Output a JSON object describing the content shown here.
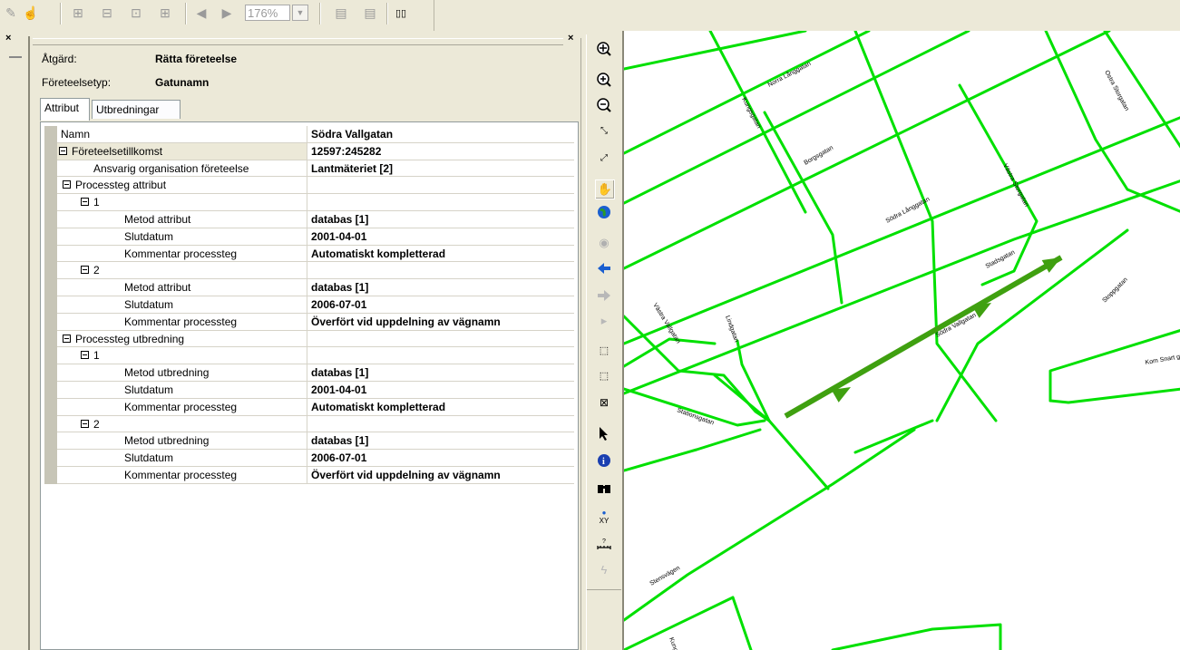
{
  "toolbar": {
    "zoom_value": "176%"
  },
  "panel": {
    "action_label": "Åtgärd:",
    "action_value": "Rätta företeelse",
    "type_label": "Företeelsetyp:",
    "type_value": "Gatunamn",
    "tabs": [
      {
        "label": "Attribut"
      },
      {
        "label": "Utbredningar"
      }
    ]
  },
  "grid": {
    "rows": [
      {
        "name": "Namn",
        "value": "Södra Vallgatan"
      },
      {
        "name": "Företeelsetillkomst",
        "value": "12597:245282"
      },
      {
        "name": "Ansvarig organisation företeelse",
        "value": "Lantmäteriet [2]"
      },
      {
        "name": "Processteg attribut",
        "value": ""
      },
      {
        "name": "1",
        "value": ""
      },
      {
        "name": "Metod attribut",
        "value": "databas [1]"
      },
      {
        "name": "Slutdatum",
        "value": "2001-04-01"
      },
      {
        "name": "Kommentar processteg",
        "value": "Automatiskt kompletterad"
      },
      {
        "name": "2",
        "value": ""
      },
      {
        "name": "Metod attribut",
        "value": "databas [1]"
      },
      {
        "name": "Slutdatum",
        "value": "2006-07-01"
      },
      {
        "name": "Kommentar processteg",
        "value": "Överfört vid uppdelning av vägnamn"
      },
      {
        "name": "Processteg utbredning",
        "value": ""
      },
      {
        "name": "1",
        "value": ""
      },
      {
        "name": "Metod utbredning",
        "value": "databas [1]"
      },
      {
        "name": "Slutdatum",
        "value": "2001-04-01"
      },
      {
        "name": "Kommentar processteg",
        "value": "Automatiskt kompletterad"
      },
      {
        "name": "2",
        "value": ""
      },
      {
        "name": "Metod utbredning",
        "value": "databas [1]"
      },
      {
        "name": "Slutdatum",
        "value": "2006-07-01"
      },
      {
        "name": "Kommentar processteg",
        "value": "Överfört vid uppdelning av vägnamn"
      }
    ]
  },
  "map": {
    "street_color": "#00e000",
    "selected_color": "#3fa010",
    "labels": [
      "Norra Långgatan",
      "Kungsgatan",
      "Ostra Storgatan",
      "Borgsgatan",
      "Södra Långgatan",
      "Västra Storgatan",
      "Stadsgatan",
      "Västra Vallgatan",
      "Lindgatan",
      "Stoppgatan",
      "Kom Snart gen",
      "Stationsgatan",
      "Södra Vallgatan",
      "Stensvägen",
      "Kungsgatan"
    ]
  },
  "icons": {
    "vertical_toolbar": [
      "zoom-to-full-icon",
      "zoom-in-icon",
      "zoom-out-icon",
      "zoom-in-fixed-icon",
      "zoom-out-fixed-icon",
      "pan-hand-icon",
      "globe-icon",
      "refresh-icon",
      "back-arrow-icon",
      "forward-arrow-icon",
      "select-arrow-icon",
      "select-features-icon",
      "select-by-graphics-icon",
      "clear-selection-icon",
      "pointer-icon",
      "identify-icon",
      "find-binoculars-icon",
      "go-to-xy-icon",
      "measure-icon",
      "flash-icon"
    ]
  }
}
